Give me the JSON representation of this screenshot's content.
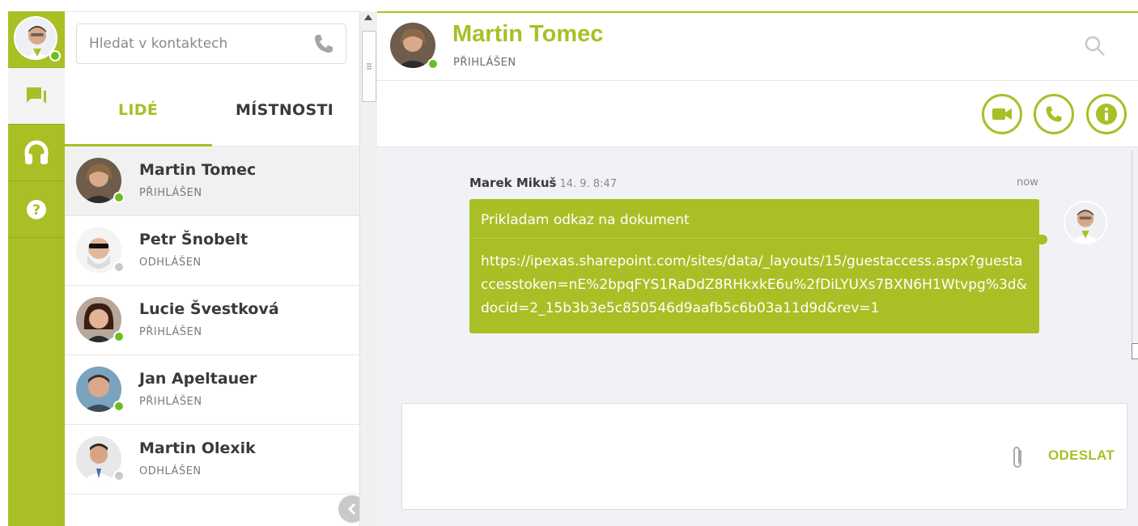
{
  "user": {
    "status_color": "#6cbe1f"
  },
  "rail": {
    "items": [
      {
        "icon": "chat-icon",
        "active": true
      },
      {
        "icon": "headset-icon",
        "active": false
      },
      {
        "icon": "help-icon",
        "active": false
      }
    ]
  },
  "search": {
    "placeholder": "Hledat v kontaktech",
    "icon": "phone-icon"
  },
  "tabs": {
    "people": "LIDÉ",
    "rooms": "MÍSTNOSTI"
  },
  "contacts": [
    {
      "name": "Martin Tomec",
      "status": "PŘIHLÁŠEN",
      "online": true,
      "selected": true
    },
    {
      "name": "Petr Šnobelt",
      "status": "ODHLÁŠEN",
      "online": false,
      "selected": false
    },
    {
      "name": "Lucie Švestková",
      "status": "PŘIHLÁŠEN",
      "online": true,
      "selected": false
    },
    {
      "name": "Jan Apeltauer",
      "status": "PŘIHLÁŠEN",
      "online": true,
      "selected": false
    },
    {
      "name": "Martin Olexik",
      "status": "ODHLÁŠEN",
      "online": false,
      "selected": false
    }
  ],
  "chat": {
    "name": "Martin Tomec",
    "status": "PŘIHLÁŠEN",
    "actions": [
      "video-call-icon",
      "phone-call-icon",
      "info-icon"
    ],
    "message": {
      "author": "Marek Mikuš",
      "date": "14. 9. 8:47",
      "relative_time": "now",
      "title": "Prikladam odkaz na dokument",
      "link": "https://ipexas.sharepoint.com/sites/data/_layouts/15/guestac­cess.aspx?guestaccesstoken=nE%2bpqFYS1RaDdZ8RHkxkE6u%2fDi­LYUXs7BXN6H1Wtvpg%3d&do­cid=2_15b3b3e5c850546d9aafb5c6b03a11d9d&rev=1"
    },
    "send_label": "ODESLAT"
  },
  "colors": {
    "accent": "#a9bf25",
    "online": "#6cbe1f",
    "offline": "#c9c9c9"
  }
}
